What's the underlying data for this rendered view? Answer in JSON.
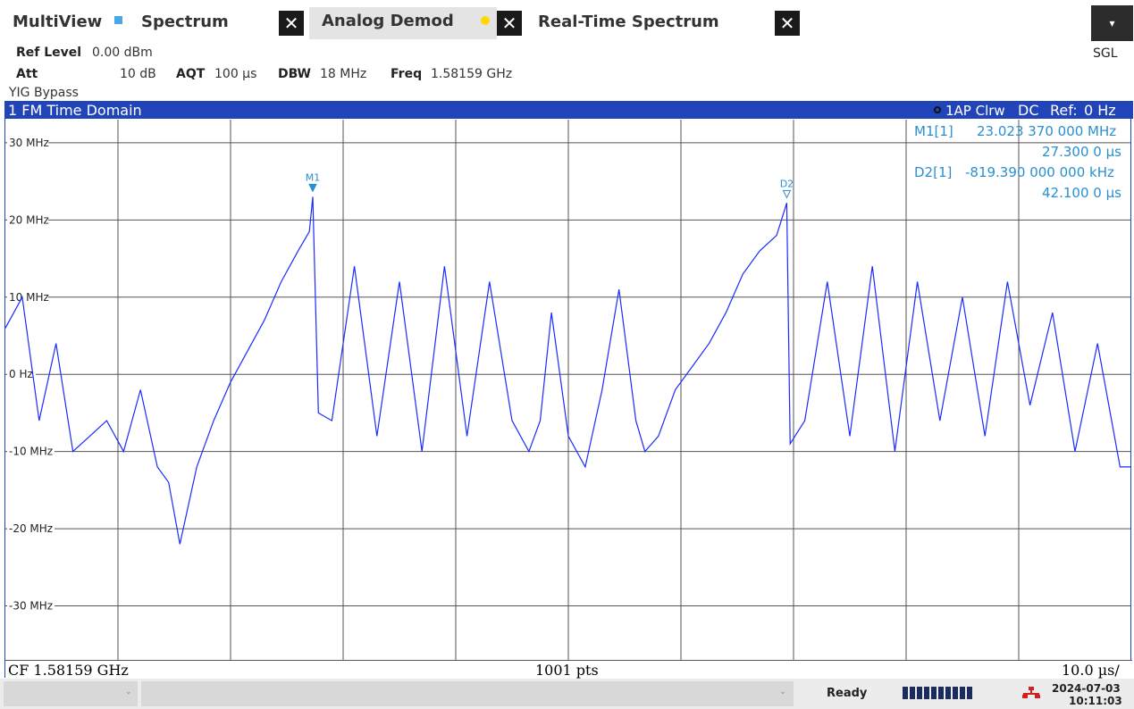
{
  "tabs": [
    {
      "label": "MultiView"
    },
    {
      "label": "Spectrum"
    },
    {
      "label": "Analog Demod"
    },
    {
      "label": "Real-Time Spectrum"
    }
  ],
  "tab_close_glyph": "✕",
  "sgl_label": "SGL",
  "settings": {
    "ref_level_label": "Ref Level",
    "ref_level_value": "0.00 dBm",
    "att_label": "Att",
    "att_value": "10 dB",
    "aqt_label": "AQT",
    "aqt_value": "100 µs",
    "dbw_label": "DBW",
    "dbw_value": "18 MHz",
    "freq_label": "Freq",
    "freq_value": "1.58159 GHz",
    "yig_label": "YIG Bypass"
  },
  "diagram": {
    "title": "1 FM Time Domain",
    "trace_info": "1AP Clrw",
    "coupling": "DC",
    "ref_label": "Ref:",
    "ref_value": "0 Hz",
    "markers": {
      "m1_line1_label": "M1[1]",
      "m1_line1_value": "23.023 370 000 MHz",
      "m1_line2_value": "27.300 0 µs",
      "d2_line1_label": "D2[1]",
      "d2_line1_value": "-819.390 000 000 kHz",
      "d2_line2_value": "42.100 0 µs",
      "m1_tag": "M1",
      "d2_tag": "D2"
    },
    "footer_left": "CF 1.58159 GHz",
    "footer_center": "1001 pts",
    "footer_right": "10.0 µs/",
    "trace_color": "#1a2bff",
    "marker_color": "#2a8fd0",
    "header_color": "#2145b8"
  },
  "chart_data": {
    "type": "line",
    "title": "1 FM Time Domain",
    "xlabel": "",
    "ylabel": "",
    "x_unit": "µs",
    "xlim": [
      0,
      100
    ],
    "x_per_division": "10.0 µs/",
    "y_unit": "MHz",
    "ylim": [
      -37,
      33
    ],
    "y_ticks": [
      "30 MHz",
      "20 MHz",
      "10 MHz",
      "0 Hz",
      "-10 MHz",
      "-20 MHz",
      "-30 MHz"
    ],
    "y_tick_values": [
      30,
      20,
      10,
      0,
      -10,
      -20,
      -30
    ],
    "points": 1001,
    "grid": true,
    "series": [
      {
        "values_x_us": [
          0,
          1.5,
          3,
          4.5,
          6,
          7.5,
          9,
          10.5,
          12,
          13.5,
          14.5,
          15.5,
          17,
          18.5,
          20,
          21.5,
          23,
          24.5,
          26,
          27,
          27.3,
          27.8,
          29,
          31,
          33,
          35,
          37,
          39,
          41,
          43,
          45,
          46.5,
          47.5,
          48.5,
          50,
          51.5,
          53,
          54.5,
          56,
          56.8,
          58,
          59.5,
          61,
          62.5,
          64,
          65.5,
          67,
          68.5,
          69.4,
          69.7,
          71,
          73,
          75,
          77,
          79,
          81,
          83,
          85,
          87,
          89,
          91,
          93,
          95,
          97,
          99,
          100
        ],
        "values_mhz": [
          6,
          10,
          -6,
          4,
          -10,
          -8,
          -6,
          -10,
          -2,
          -12,
          -14,
          -22,
          -12,
          -6,
          -1,
          3,
          7,
          12,
          16,
          18.5,
          23.0,
          -5,
          -6,
          14,
          -8,
          12,
          -10,
          14,
          -8,
          12,
          -6,
          -10,
          -6,
          8,
          -8,
          -12,
          -2,
          11,
          -6,
          -10,
          -8,
          -2,
          1,
          4,
          8,
          13,
          16,
          18,
          22.2,
          -9,
          -6,
          12,
          -8,
          14,
          -10,
          12,
          -6,
          10,
          -8,
          12,
          -4,
          8,
          -10,
          4,
          -12,
          -12
        ]
      }
    ]
  },
  "status": {
    "ready": "Ready",
    "date": "2024-07-03",
    "time": "10:11:03"
  }
}
